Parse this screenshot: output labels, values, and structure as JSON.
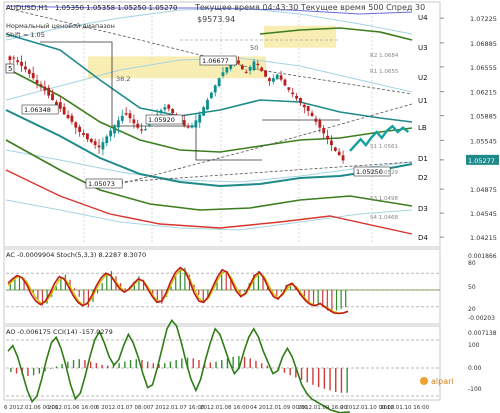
{
  "header": {
    "symbol": "AUDUSD,H1",
    "ohlc": "1.05350 1.05358 1.05250 1.05270",
    "note1": "Нормальный ценовой диапазон",
    "note2": "Shift = 1.05",
    "server_line": "Текущее время 04:43:30 Текущее время 500 Спред 30",
    "balance": "$9573.94"
  },
  "main_chart": {
    "price_ticks": [
      "1.07225",
      "1.06885",
      "1.06555",
      "1.06215",
      "1.05885",
      "1.05545",
      "1.05277",
      "1.04875",
      "1.04545",
      "1.04215"
    ],
    "current_price_label": "1.05277",
    "right_labels": [
      "U4",
      "U3",
      "U2",
      "U1",
      "LB",
      "D1",
      "D2",
      "D3",
      "D4"
    ],
    "inner_labels": [
      "R2 1.0684",
      "R1 1.0655",
      "S1 1.0561",
      "S2 1.0529",
      "S3 1.0498",
      "S4 1.0468"
    ],
    "annotations": [
      {
        "text": "1.06677"
      },
      {
        "text": "1.06348"
      },
      {
        "text": "1.05920"
      },
      {
        "text": "1.05073"
      },
      {
        "text": "1.05250"
      },
      {
        "text": "38.2"
      },
      {
        "text": "50"
      }
    ],
    "pivot_marker": "5",
    "chart_data": {
      "type": "candlestick",
      "series_name": "AUDUSD H1",
      "close": [
        1.0665,
        1.0668,
        1.0662,
        1.0657,
        1.0652,
        1.0646,
        1.064,
        1.0633,
        1.0628,
        1.0623,
        1.0616,
        1.061,
        1.0603,
        1.0598,
        1.059,
        1.0585,
        1.058,
        1.0572,
        1.0566,
        1.0562,
        1.0556,
        1.0552,
        1.0548,
        1.0545,
        1.0552,
        1.056,
        1.0568,
        1.0575,
        1.0582,
        1.0588,
        1.059,
        1.0585,
        1.0578,
        1.0572,
        1.0568,
        1.057,
        1.0576,
        1.0583,
        1.059,
        1.0596,
        1.06,
        1.0598,
        1.0592,
        1.0586,
        1.058,
        1.0575,
        1.0572,
        1.0575,
        1.0582,
        1.059,
        1.06,
        1.061,
        1.062,
        1.063,
        1.064,
        1.0648,
        1.0655,
        1.0662,
        1.0667,
        1.066,
        1.0652,
        1.0648,
        1.0655,
        1.0663,
        1.0658,
        1.065,
        1.0642,
        1.0636,
        1.064,
        1.0645,
        1.0638,
        1.063,
        1.0624,
        1.0618,
        1.0612,
        1.0606,
        1.06,
        1.0595,
        1.0588,
        1.058,
        1.0572,
        1.0564,
        1.0556,
        1.0548,
        1.054,
        1.0534,
        1.0527
      ],
      "forecast": [
        1.054,
        1.0548,
        1.0556,
        1.0548,
        1.0558,
        1.0566,
        1.0558,
        1.0568,
        1.0574,
        1.0566,
        1.0572,
        1.0566
      ],
      "price_range": [
        1.0412,
        1.0742
      ]
    }
  },
  "ac_panel": {
    "label": "AC -0.0009904  Stoch(5,3,3) 8.2287 8.3070",
    "ticks": [
      "0.001866",
      "80",
      "50",
      "20",
      "-0.00203"
    ],
    "chart_data": {
      "type": "line+histogram",
      "stoch_main": [
        62,
        70,
        76,
        72,
        60,
        42,
        30,
        24,
        30,
        44,
        62,
        74,
        70,
        56,
        40,
        28,
        22,
        26,
        40,
        58,
        72,
        80,
        76,
        64,
        52,
        46,
        52,
        62,
        70,
        66,
        52,
        38,
        28,
        30,
        46,
        66,
        82,
        90,
        84,
        66,
        44,
        30,
        28,
        38,
        56,
        74,
        86,
        82,
        66,
        48,
        38,
        44,
        60,
        76,
        82,
        70,
        52,
        38,
        34,
        44,
        58,
        62,
        52,
        40,
        30,
        24,
        22,
        26,
        20,
        14,
        9,
        8,
        9,
        12
      ],
      "stoch_signal": [
        58,
        66,
        73,
        73,
        65,
        50,
        36,
        27,
        28,
        38,
        54,
        68,
        71,
        62,
        46,
        32,
        24,
        25,
        35,
        52,
        66,
        77,
        77,
        67,
        56,
        48,
        50,
        59,
        68,
        67,
        56,
        42,
        31,
        30,
        41,
        59,
        76,
        86,
        85,
        71,
        51,
        35,
        29,
        35,
        50,
        68,
        81,
        83,
        71,
        54,
        41,
        42,
        55,
        71,
        80,
        74,
        58,
        43,
        36,
        41,
        53,
        60,
        55,
        44,
        33,
        26,
        23,
        25,
        21,
        16,
        11,
        9,
        9,
        11
      ],
      "ac_hist": [
        0.0004,
        0.0006,
        0.0008,
        0.0007,
        0.0003,
        -0.0002,
        -0.0006,
        -0.0009,
        -0.0008,
        -0.0004,
        0.0002,
        0.0007,
        0.0009,
        0.0006,
        0.0001,
        -0.0004,
        -0.0008,
        -0.001,
        -0.0007,
        -0.0002,
        0.0004,
        0.0009,
        0.0011,
        0.0008,
        0.0004,
        0.0001,
        0.0002,
        0.0005,
        0.0008,
        0.0006,
        0.0002,
        -0.0003,
        -0.0007,
        -0.0008,
        -0.0004,
        0.0002,
        0.0008,
        0.0012,
        0.0013,
        0.0009,
        0.0003,
        -0.0003,
        -0.0007,
        -0.0005,
        0.0001,
        0.0007,
        0.0011,
        0.001,
        0.0006,
        0.0001,
        -0.0003,
        -0.0001,
        0.0004,
        0.0009,
        0.0011,
        0.0008,
        0.0003,
        -0.0002,
        -0.0004,
        -0.0001,
        0.0003,
        0.0004,
        0.0001,
        -0.0003,
        -0.0006,
        -0.0008,
        -0.0009,
        -0.0008,
        -0.001,
        -0.0012,
        -0.0013,
        -0.0012,
        -0.0011,
        -0.001
      ],
      "levels": [
        80,
        50,
        20
      ]
    }
  },
  "ao_panel": {
    "label": "AO -0.006175  CCI(14) -157.0279",
    "ticks": [
      "0.007138",
      "100",
      "0.00",
      "-100"
    ],
    "chart_data": {
      "type": "line+histogram",
      "cci": [
        60,
        80,
        40,
        -20,
        -80,
        -120,
        -100,
        -40,
        30,
        90,
        110,
        70,
        10,
        -60,
        -110,
        -90,
        -30,
        40,
        100,
        130,
        90,
        40,
        10,
        30,
        80,
        120,
        90,
        40,
        -20,
        -70,
        -60,
        0,
        70,
        140,
        170,
        150,
        90,
        20,
        -40,
        -80,
        -40,
        30,
        90,
        140,
        120,
        70,
        20,
        -20,
        0,
        60,
        110,
        140,
        110,
        60,
        20,
        -20,
        -10,
        40,
        70,
        40,
        -10,
        -60,
        -90,
        -110,
        -120,
        -130,
        -140,
        -150,
        -155,
        -160,
        -158,
        -157
      ],
      "ao_hist": [
        -0.001,
        -0.0014,
        -0.0018,
        -0.002,
        -0.0018,
        -0.0014,
        -0.0008,
        -0.0002,
        0.0004,
        0.001,
        0.0016,
        0.002,
        0.0022,
        0.002,
        0.0016,
        0.0012,
        0.0008,
        0.0006,
        0.0008,
        0.0012,
        0.0016,
        0.002,
        0.0022,
        0.002,
        0.0016,
        0.0012,
        0.001,
        0.0012,
        0.0016,
        0.002,
        0.0024,
        0.0026,
        0.0024,
        0.002,
        0.0016,
        0.0014,
        0.0016,
        0.002,
        0.0024,
        0.0028,
        0.003,
        0.0028,
        0.0024,
        0.0018,
        0.0012,
        0.0006,
        0.0,
        -0.0006,
        -0.0012,
        -0.0018,
        -0.0024,
        -0.003,
        -0.0036,
        -0.0042,
        -0.0048,
        -0.0052,
        -0.0056,
        -0.006,
        -0.0062,
        -0.0062
      ],
      "levels": [
        100,
        0,
        -100
      ]
    },
    "watermark": "alpari"
  },
  "time_axis": {
    "labels": [
      "6 2012.01.06 00:00",
      "2012.01.06 16:00",
      "6 2012.01.07 08:00",
      "7 2012.01.07 16:00",
      "2012.01.08 16:00",
      "04 2012.01.09 00:00",
      "2012.01.09 16:00",
      "9 2012.01.10 00:00",
      "2012.01.10 16:00"
    ]
  },
  "colors": {
    "bull": "#1a9c9c",
    "bear": "#b81e1e",
    "candle_up": "#0b8e8e",
    "ma_teal": "#1f8a8a",
    "ma_green": "#3c7d1c",
    "ma_red": "#d8342c",
    "ma_lightblue": "#a6d4e4",
    "stoch_main": "#c01818",
    "stoch_signal": "#c9c200",
    "cci_line": "#2e7d16",
    "forecast": "#14a0a0"
  }
}
